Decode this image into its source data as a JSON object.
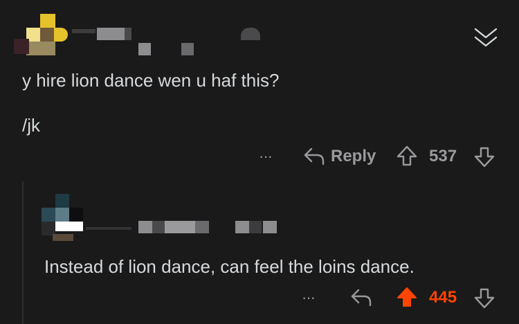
{
  "colors": {
    "background": "#1a1a1b",
    "text": "#d7dadc",
    "muted": "#9a9a9d",
    "upvote_active": "#ff4500",
    "thread_line": "#2e2e30"
  },
  "comments": [
    {
      "paragraphs": [
        "y hire lion dance wen u haf this?",
        "/jk"
      ],
      "actions": {
        "more_label": "···",
        "reply_label": "Reply",
        "score": "537",
        "upvoted": false
      }
    },
    {
      "paragraphs": [
        "Instead of lion dance, can feel the loins dance."
      ],
      "actions": {
        "more_label": "···",
        "score": "445",
        "upvoted": true
      }
    }
  ],
  "header": {
    "collapse_icon": "double-chevron-down-icon"
  }
}
